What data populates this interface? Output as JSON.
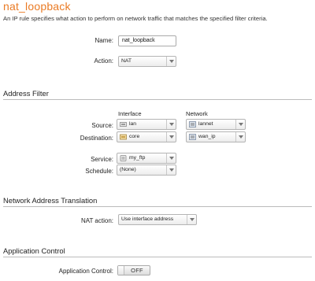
{
  "page": {
    "title": "nat_loopback",
    "description": "An IP rule specifies what action to perform on network traffic that matches the specified filter criteria."
  },
  "general": {
    "name_label": "Name:",
    "name_value": "nat_loopback",
    "action_label": "Action:",
    "action_value": "NAT"
  },
  "address_filter": {
    "heading": "Address Filter",
    "interface_header": "Interface",
    "network_header": "Network",
    "source_label": "Source:",
    "source_interface": "lan",
    "source_network": "lannet",
    "destination_label": "Destination:",
    "destination_interface": "core",
    "destination_network": "wan_ip",
    "service_label": "Service:",
    "service_value": "my_ftp",
    "schedule_label": "Schedule:",
    "schedule_value": "(None)"
  },
  "nat": {
    "heading": "Network Address Translation",
    "action_label": "NAT action:",
    "action_value": "Use interface address"
  },
  "app_control": {
    "heading": "Application Control",
    "label": "Application Control:",
    "toggle_value": "OFF"
  },
  "colors": {
    "title": "#ea7b25",
    "section_rule": "#bbbbbb"
  }
}
